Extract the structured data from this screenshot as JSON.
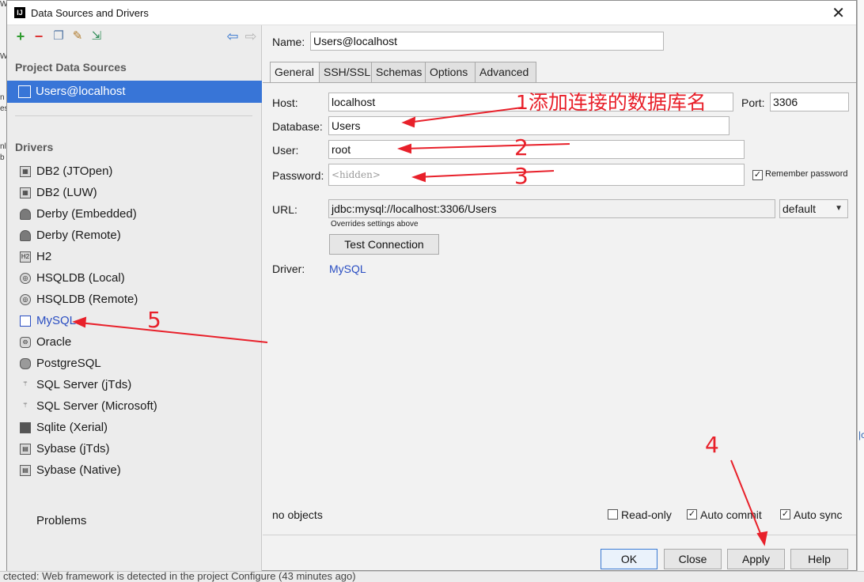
{
  "background": {
    "bottom_status": "ctected: Web framework is detected in the project Configure (43 minutes ago)"
  },
  "dialog": {
    "title": "Data Sources and Drivers"
  },
  "left": {
    "project_data_sources_label": "Project Data Sources",
    "data_source": "Users@localhost",
    "drivers_label": "Drivers",
    "drivers": [
      "DB2 (JTOpen)",
      "DB2 (LUW)",
      "Derby (Embedded)",
      "Derby (Remote)",
      "H2",
      "HSQLDB (Local)",
      "HSQLDB (Remote)",
      "MySQL",
      "Oracle",
      "PostgreSQL",
      "SQL Server (jTds)",
      "SQL Server (Microsoft)",
      "Sqlite (Xerial)",
      "Sybase (jTds)",
      "Sybase (Native)"
    ],
    "problems_label": "Problems"
  },
  "form": {
    "name_label": "Name:",
    "name_value": "Users@localhost",
    "tabs": [
      "General",
      "SSH/SSL",
      "Schemas",
      "Options",
      "Advanced"
    ],
    "host_label": "Host:",
    "host_value": "localhost",
    "port_label": "Port:",
    "port_value": "3306",
    "database_label": "Database:",
    "database_value": "Users",
    "user_label": "User:",
    "user_value": "root",
    "password_label": "Password:",
    "password_value": "<hidden>",
    "remember_password_label": "Remember password",
    "url_label": "URL:",
    "url_value": "jdbc:mysql://localhost:3306/Users",
    "url_mode": "default",
    "url_hint": "Overrides settings above",
    "test_connection_label": "Test Connection",
    "driver_label": "Driver:",
    "driver_value": "MySQL",
    "status": "no objects",
    "readonly_label": "Read-only",
    "auto_commit_label": "Auto commit",
    "auto_sync_label": "Auto sync"
  },
  "buttons": {
    "ok": "OK",
    "close": "Close",
    "apply": "Apply",
    "help": "Help"
  },
  "annotations": {
    "a1": "1添加连接的数据库名",
    "a2": "2",
    "a3": "3",
    "a4": "4",
    "a5": "5"
  },
  "annotation_color": "#e8202a",
  "accent_color": "#3875d7"
}
